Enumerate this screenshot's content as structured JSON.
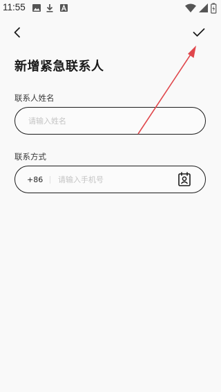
{
  "status_bar": {
    "time": "11:55",
    "left_icons": [
      "image-icon",
      "download-icon",
      "font-app-icon"
    ],
    "right_icons": [
      "wifi-icon",
      "signal-icon",
      "battery-icon"
    ]
  },
  "nav": {
    "back_icon": "chevron-left-icon",
    "confirm_icon": "checkmark-icon"
  },
  "page": {
    "title": "新增紧急联系人"
  },
  "form": {
    "name_label": "联系人姓名",
    "name_placeholder": "请输入姓名",
    "name_value": "",
    "contact_label": "联系方式",
    "country_code": "+86",
    "phone_placeholder": "请输入手机号",
    "phone_value": "",
    "contact_book_icon": "contact-book-icon"
  },
  "colors": {
    "background": "#f9f9f9",
    "text": "#1a1a1a",
    "annotation_arrow": "#e0474c"
  }
}
